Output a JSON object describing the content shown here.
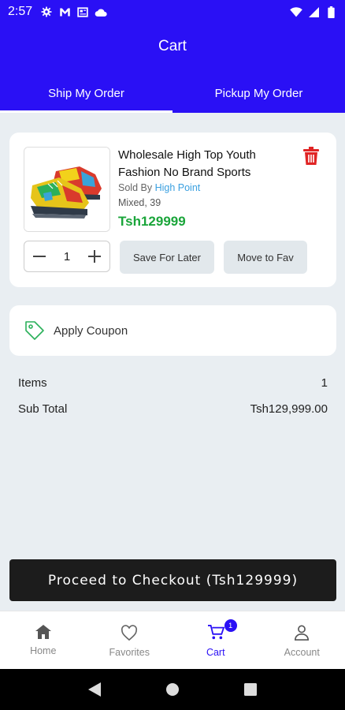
{
  "status_bar": {
    "time": "2:57"
  },
  "header": {
    "title": "Cart",
    "tabs": [
      {
        "label": "Ship My Order",
        "active": true
      },
      {
        "label": "Pickup My Order",
        "active": false
      }
    ]
  },
  "cart_item": {
    "name": "Wholesale High Top Youth Fashion No Brand Sports",
    "sold_by_prefix": "Sold By",
    "seller": "High Point",
    "variant": "Mixed, 39",
    "price": "Tsh129999",
    "quantity": "1",
    "save_later_label": "Save For Later",
    "move_fav_label": "Move to Fav"
  },
  "coupon": {
    "label": "Apply Coupon"
  },
  "summary": {
    "items_label": "Items",
    "items_value": "1",
    "subtotal_label": "Sub Total",
    "subtotal_value": "Tsh129,999.00"
  },
  "checkout": {
    "label": "Proceed to Checkout (Tsh129999)"
  },
  "bottom_nav": {
    "items": [
      {
        "label": "Home",
        "icon": "home-icon"
      },
      {
        "label": "Favorites",
        "icon": "heart-icon"
      },
      {
        "label": "Cart",
        "icon": "cart-icon",
        "badge": "1",
        "active": true
      },
      {
        "label": "Account",
        "icon": "person-icon"
      }
    ]
  },
  "colors": {
    "primary": "#2a10f5",
    "price": "#1aa53a",
    "delete": "#e02424",
    "seller_link": "#3aa0e0"
  }
}
